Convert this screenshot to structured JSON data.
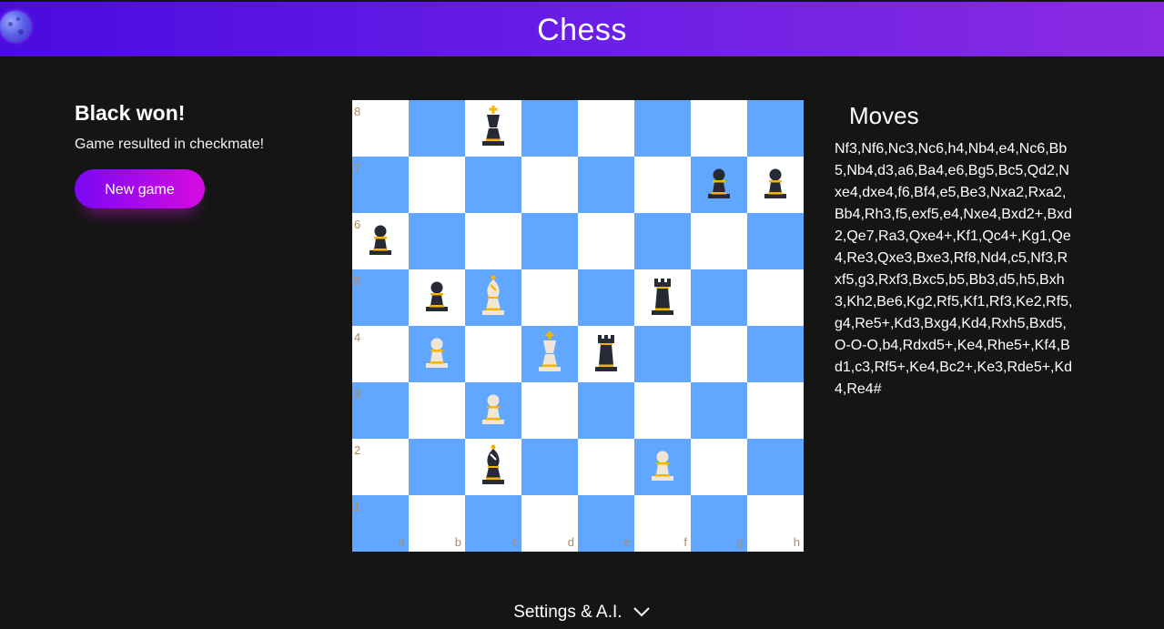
{
  "header": {
    "title": "Chess",
    "theme_toggle_icon": "moon-icon"
  },
  "status": {
    "title": "Black won!",
    "subtitle": "Game resulted in checkmate!"
  },
  "controls": {
    "new_game_label": "New game"
  },
  "board": {
    "colors": {
      "light": "#ffffff",
      "dark": "#61a6ff",
      "coordinate": "#b08a5e",
      "gold": "#f5b400",
      "black_piece": "#262a35",
      "white_piece": "#f1e6d5"
    },
    "files": [
      "a",
      "b",
      "c",
      "d",
      "e",
      "f",
      "g",
      "h"
    ],
    "ranks": [
      "8",
      "7",
      "6",
      "5",
      "4",
      "3",
      "2",
      "1"
    ],
    "pieces": [
      {
        "square": "c8",
        "color": "black",
        "type": "king"
      },
      {
        "square": "g7",
        "color": "black",
        "type": "pawn"
      },
      {
        "square": "h7",
        "color": "black",
        "type": "pawn"
      },
      {
        "square": "a6",
        "color": "black",
        "type": "pawn"
      },
      {
        "square": "b5",
        "color": "black",
        "type": "pawn"
      },
      {
        "square": "c5",
        "color": "white",
        "type": "bishop"
      },
      {
        "square": "f5",
        "color": "black",
        "type": "rook"
      },
      {
        "square": "b4",
        "color": "white",
        "type": "pawn"
      },
      {
        "square": "d4",
        "color": "white",
        "type": "king"
      },
      {
        "square": "e4",
        "color": "black",
        "type": "rook"
      },
      {
        "square": "c3",
        "color": "white",
        "type": "pawn"
      },
      {
        "square": "c2",
        "color": "black",
        "type": "bishop"
      },
      {
        "square": "f2",
        "color": "white",
        "type": "pawn"
      }
    ]
  },
  "moves": {
    "title": "Moves",
    "list": "Nf3,Nf6,Nc3,Nc6,h4,Nb4,e4,Nc6,Bb5,Nb4,d3,a6,Ba4,e6,Bg5,Bc5,Qd2,Nxe4,dxe4,f6,Bf4,e5,Be3,Nxa2,Rxa2,Bb4,Rh3,f5,exf5,e4,Nxe4,Bxd2+,Bxd2,Qe7,Ra3,Qxe4+,Kf1,Qc4+,Kg1,Qe4,Re3,Qxe3,Bxe3,Rf8,Nd4,c5,Nf3,Rxf5,g3,Rxf3,Bxc5,b5,Bb3,d5,h5,Bxh3,Kh2,Be6,Kg2,Rf5,Kf1,Rf3,Ke2,Rf5,g4,Re5+,Kd3,Bxg4,Kd4,Rxh5,Bxd5,O-O-O,b4,Rdxd5+,Ke4,Rhe5+,Kf4,Bd1,c3,Rf5+,Ke4,Bc2+,Ke3,Rde5+,Kd4,Re4#"
  },
  "settings": {
    "label": "Settings & A.I.",
    "icon": "chevron-down-icon"
  }
}
